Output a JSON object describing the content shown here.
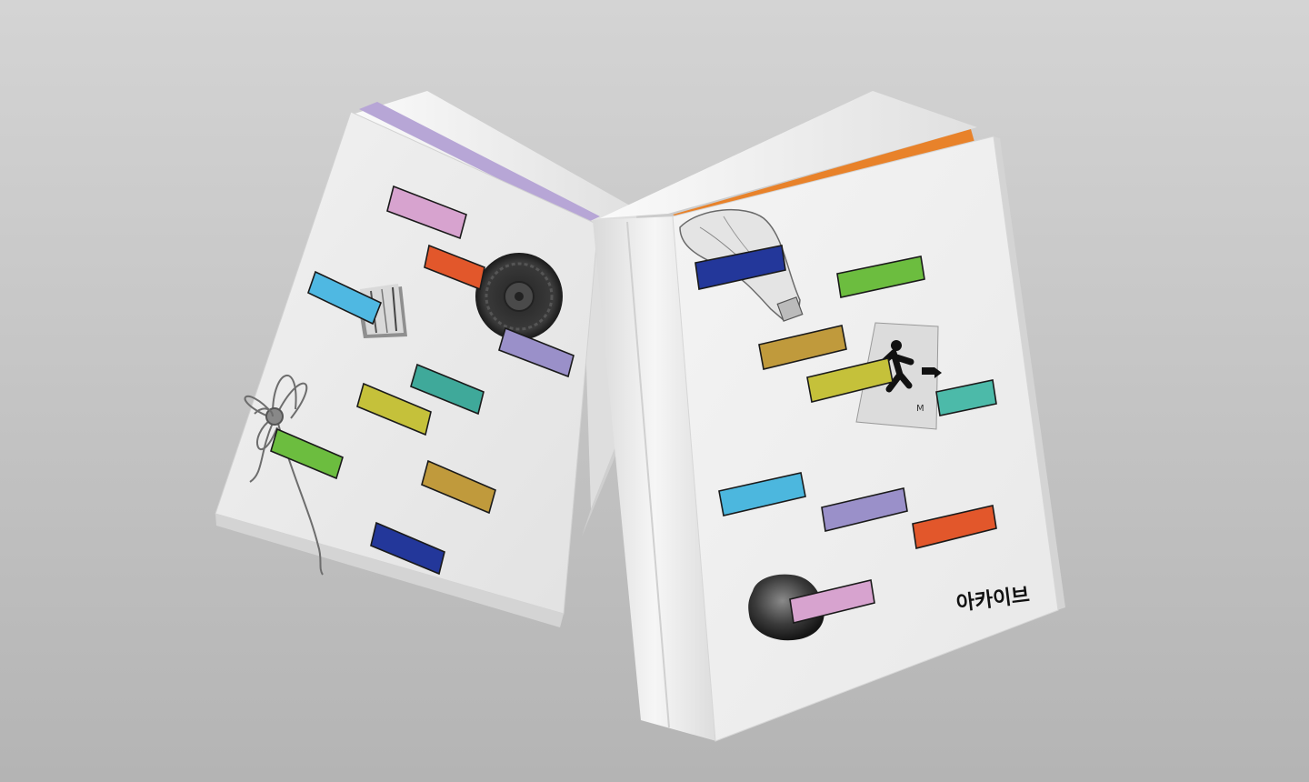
{
  "cover_title": "아카이브",
  "colors": {
    "background": "#c9c9c9",
    "cover": "#efefef",
    "left_book_pages_edge": "#b7a6d6",
    "right_book_pages_edge": "#e8822a",
    "pink": "#d7a3cf",
    "orange_red": "#e2572b",
    "sky_blue": "#4fb8e2",
    "lavender": "#9a90c9",
    "teal": "#3fa99a",
    "olive_yellow": "#c5c13a",
    "green": "#6cbd3f",
    "ochre": "#c09a3c",
    "navy": "#23379a",
    "light_blue": "#4cb7de",
    "mint": "#4cbaa9"
  },
  "left_book_collage": [
    "tape-roll",
    "tire",
    "twine-knot"
  ],
  "right_book_collage": [
    "plastic-bottle",
    "exit-sign",
    "rock"
  ]
}
